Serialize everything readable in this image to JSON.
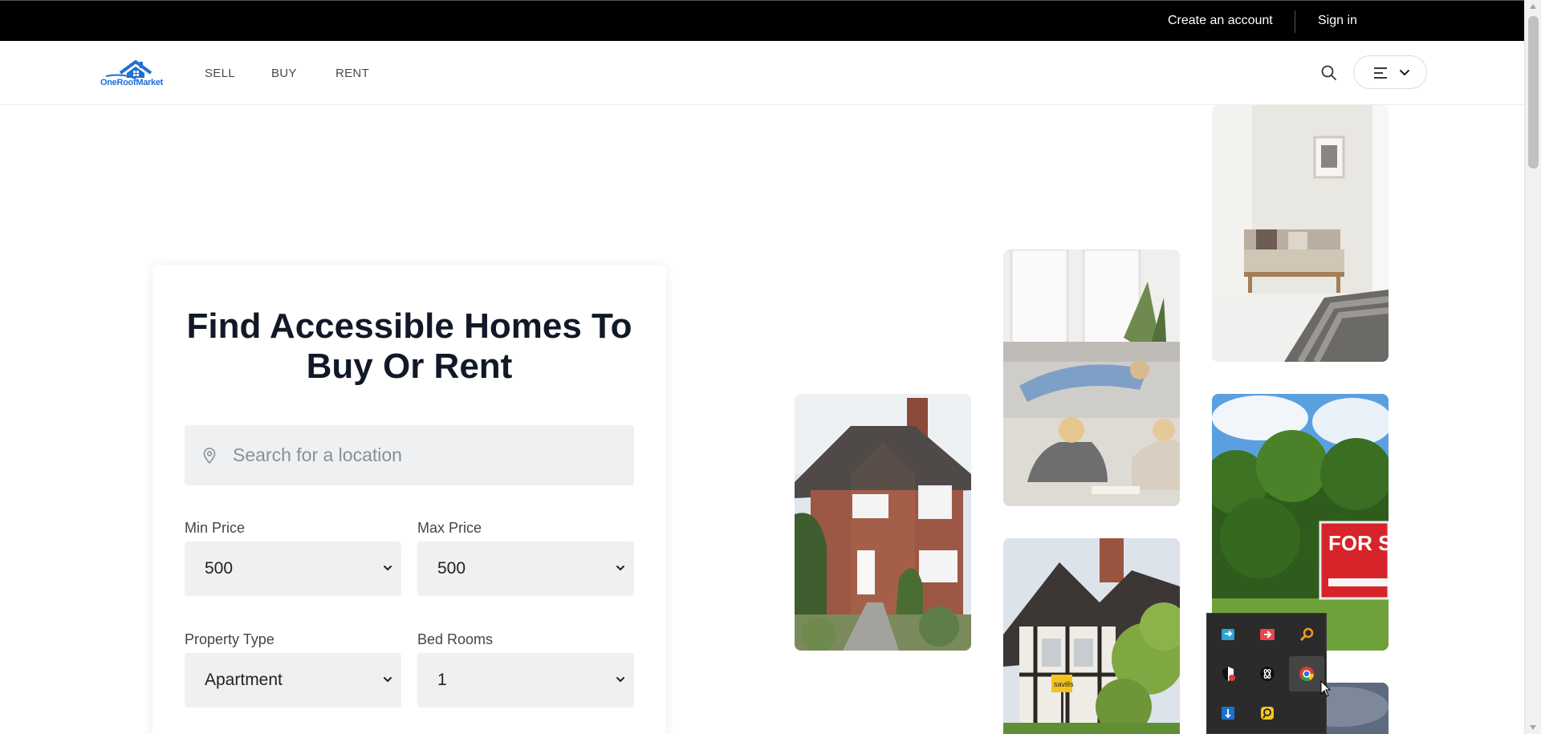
{
  "topbar": {
    "create_account": "Create an account",
    "sign_in": "Sign in"
  },
  "nav": {
    "logo_text": "OneRoofMarket",
    "sell": "SELL",
    "buy": "BUY",
    "rent": "RENT"
  },
  "hero": {
    "title_line1": "Find Accessible Homes To",
    "title_line2": "Buy Or Rent",
    "search_placeholder": "Search for a location"
  },
  "filters": {
    "min_price_label": "Min Price",
    "min_price_value": "500",
    "max_price_label": "Max Price",
    "max_price_value": "500",
    "property_type_label": "Property Type",
    "property_type_value": "Apartment",
    "bedrooms_label": "Bed Rooms",
    "bedrooms_value": "1"
  },
  "photos": {
    "sign_text": "FOR SALE",
    "estate_sign_text": "savills"
  },
  "colors": {
    "brand_blue": "#1f6fd6",
    "topbar_bg": "#000000",
    "input_bg": "#eef0f2",
    "title_color": "#111827"
  },
  "tray_icons": [
    "transfer-icon",
    "remote-icon",
    "search-tool-icon",
    "shield-icon",
    "atom-icon",
    "chrome-icon",
    "download-icon",
    "chat-icon"
  ]
}
